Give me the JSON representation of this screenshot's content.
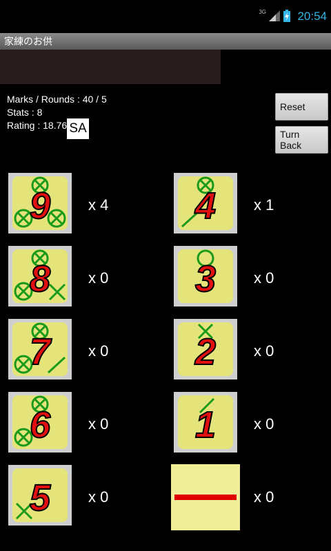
{
  "status_bar": {
    "network": "3G",
    "time": "20:54"
  },
  "app": {
    "title": "家練のお供"
  },
  "stats": {
    "marks_rounds": "Marks / Rounds : 40 / 5",
    "stats": "Stats : 8",
    "rating": "Rating : 18.76",
    "badge": "SA"
  },
  "buttons": {
    "reset": "Reset",
    "turn_back": "Turn Back"
  },
  "cells": [
    {
      "number": "9",
      "count": "x 4"
    },
    {
      "number": "4",
      "count": "x 1"
    },
    {
      "number": "8",
      "count": "x 0"
    },
    {
      "number": "3",
      "count": "x 0"
    },
    {
      "number": "7",
      "count": "x 0"
    },
    {
      "number": "2",
      "count": "x 0"
    },
    {
      "number": "6",
      "count": "x 0"
    },
    {
      "number": "1",
      "count": "x 0"
    },
    {
      "number": "5",
      "count": "x 0"
    },
    {
      "number": "",
      "count": "x 0"
    }
  ],
  "colors": {
    "card_bg": "#e4e47a",
    "number_red": "#e01010",
    "mark_green": "#1a9a1a",
    "accent": "#33b5e5"
  }
}
